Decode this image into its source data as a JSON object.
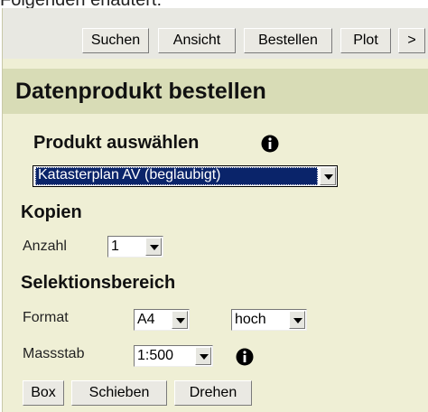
{
  "caption": "Folgenden erläutert:",
  "toolbar": {
    "search_label": "Suchen",
    "view_label": "Ansicht",
    "order_label": "Bestellen",
    "plot_label": "Plot",
    "more_label": ">"
  },
  "page_title": "Datenprodukt bestellen",
  "product": {
    "heading": "Produkt auswählen",
    "selected": "Katasterplan AV (beglaubigt)"
  },
  "copies": {
    "heading": "Kopien",
    "count_label": "Anzahl",
    "count_value": "1"
  },
  "selection": {
    "heading": "Selektionsbereich",
    "format_label": "Format",
    "format_value": "A4",
    "orientation_value": "hoch",
    "scale_label": "Massstab",
    "scale_value": "1:500"
  },
  "actions": {
    "box_label": "Box",
    "shift_label": "Schieben",
    "rotate_label": "Drehen"
  }
}
